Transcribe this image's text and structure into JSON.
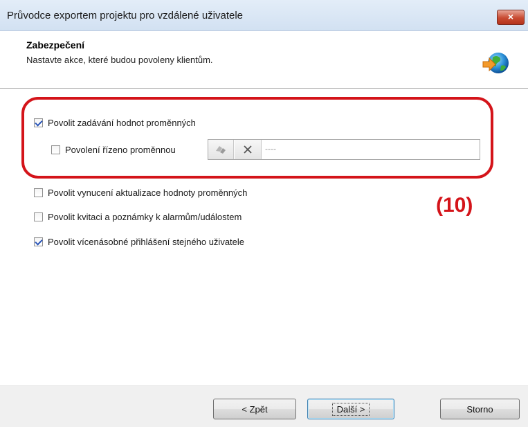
{
  "window": {
    "title": "Průvodce exportem projektu pro vzdálené uživatele",
    "close_label": "×"
  },
  "header": {
    "title": "Zabezpečení",
    "subtitle": "Nastavte akce, které budou povoleny klientům."
  },
  "options": {
    "allow_variable_input": {
      "label": "Povolit zadávání hodnot proměnných",
      "checked": true
    },
    "permission_by_variable": {
      "label": "Povolení řízeno proměnnou",
      "checked": false,
      "value": "----"
    },
    "force_update": {
      "label": "Povolit vynucení aktualizace hodnoty proměnných",
      "checked": false
    },
    "acknowledge": {
      "label": "Povolit kvitaci a poznámky k alarmům/událostem",
      "checked": false
    },
    "multi_login": {
      "label": "Povolit vícenásobné přihlášení stejného uživatele",
      "checked": true
    }
  },
  "annotation": "(10)",
  "buttons": {
    "back": "< Zpět",
    "next": "Další >",
    "cancel": "Storno"
  },
  "colors": {
    "highlight": "#d4141a",
    "titlebar": "#d2e1f2",
    "close": "#c84a31"
  }
}
